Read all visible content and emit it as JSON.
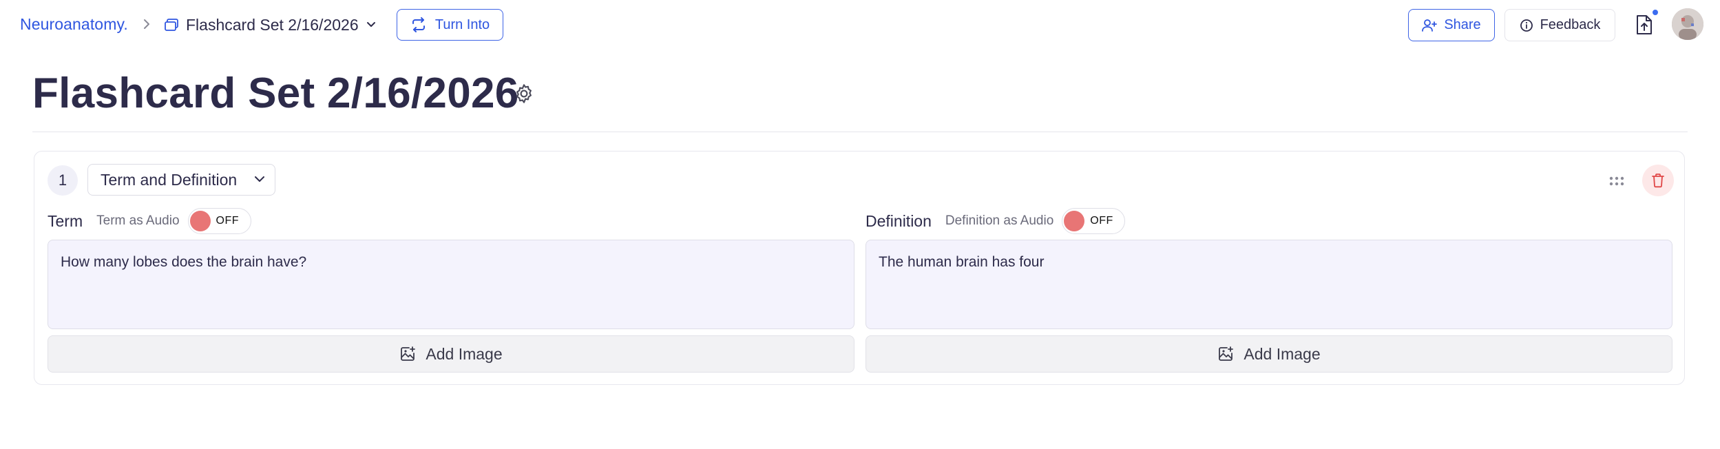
{
  "breadcrumb": {
    "workspace": "Neuroanatomy.",
    "set_name": "Flashcard Set 2/16/2026"
  },
  "toolbar": {
    "turn_into_label": "Turn Into",
    "share_label": "Share",
    "feedback_label": "Feedback"
  },
  "page": {
    "title": "Flashcard Set 2/16/2026"
  },
  "card": {
    "number": "1",
    "type": "Term and Definition",
    "term": {
      "label": "Term",
      "audio_label": "Term as Audio",
      "audio_state": "OFF",
      "text": "How many lobes does the brain have?",
      "add_image_label": "Add Image"
    },
    "definition": {
      "label": "Definition",
      "audio_label": "Definition as Audio",
      "audio_state": "OFF",
      "text": "The human brain has four",
      "add_image_label": "Add Image"
    }
  },
  "colors": {
    "accent": "#2f56e0",
    "toggle_off": "#e87575",
    "delete_bg": "#fde8e8",
    "delete_icon": "#e04646",
    "notify_dot": "#3b6cf0"
  },
  "icons": {
    "breadcrumb_separator": "chevron-right-icon",
    "set": "cards-stack-icon",
    "set_dropdown": "chevron-down-icon",
    "turn_into": "repeat-arrows-icon",
    "share": "user-plus-icon",
    "feedback": "info-circle-icon",
    "export": "file-upload-icon",
    "title_settings": "gear-icon",
    "type_dropdown": "chevron-down-icon",
    "drag": "drag-dots-icon",
    "delete": "trash-icon",
    "add_image": "image-plus-icon"
  }
}
